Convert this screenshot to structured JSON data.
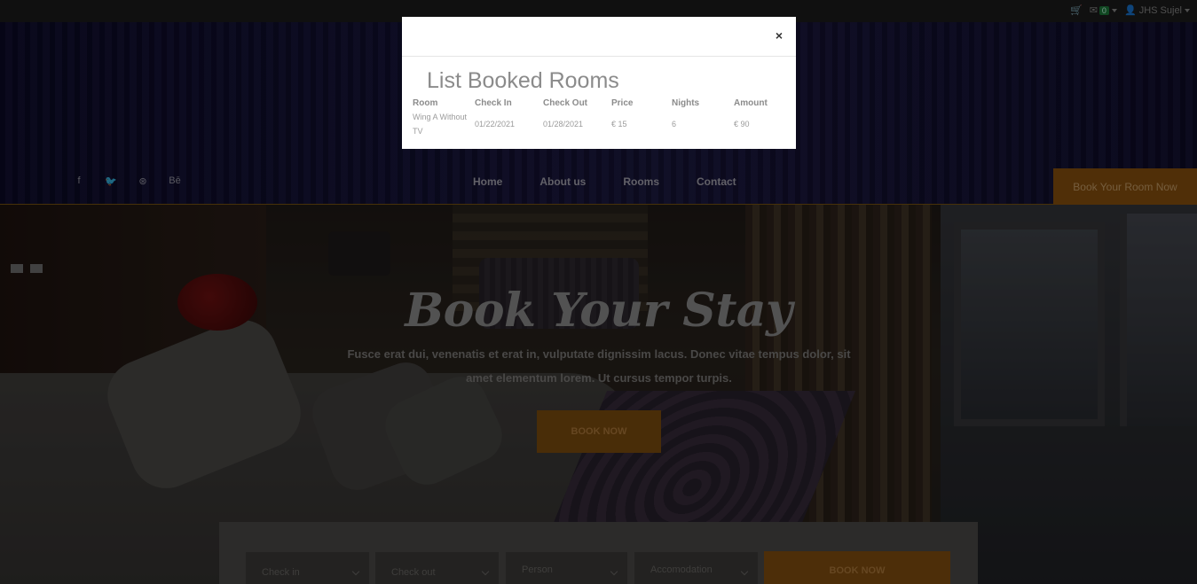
{
  "topbar": {
    "cart_icon": "shopping-cart-icon",
    "mail_icon": "envelope-icon",
    "mail_count": "0",
    "user_icon": "user-icon",
    "user_name": "JHS Sujel"
  },
  "social": [
    {
      "icon": "facebook-icon",
      "glyph": "f"
    },
    {
      "icon": "twitter-icon",
      "glyph": "🐦"
    },
    {
      "icon": "dribbble-icon",
      "glyph": "⊛"
    },
    {
      "icon": "behance-icon",
      "glyph": "Bē"
    }
  ],
  "nav": {
    "home": "Home",
    "about": "About us",
    "rooms": "Rooms",
    "contact": "Contact"
  },
  "header_cta": "Book Your Room Now",
  "hero": {
    "title": "Book Your Stay",
    "text": "Fusce erat dui, venenatis et erat in, vulputate dignissim lacus. Donec vitae tempus dolor, sit amet elementum lorem. Ut cursus tempor turpis.",
    "button": "BOOK NOW"
  },
  "booking_form": {
    "check_in": "Check in",
    "check_out": "Check out",
    "person": "Person",
    "accommodation": "Accomodation",
    "button": "BOOK NOW"
  },
  "modal": {
    "close": "×",
    "title": "List Booked Rooms",
    "columns": [
      "Room",
      "Check In",
      "Check Out",
      "Price",
      "Nights",
      "Amount"
    ],
    "rows": [
      [
        "Wing A Without TV",
        "01/22/2021",
        "01/28/2021",
        "€ 15",
        "6",
        "€ 90"
      ]
    ]
  },
  "colors": {
    "accent": "#e08a1e",
    "header_bg": "#15133a"
  }
}
